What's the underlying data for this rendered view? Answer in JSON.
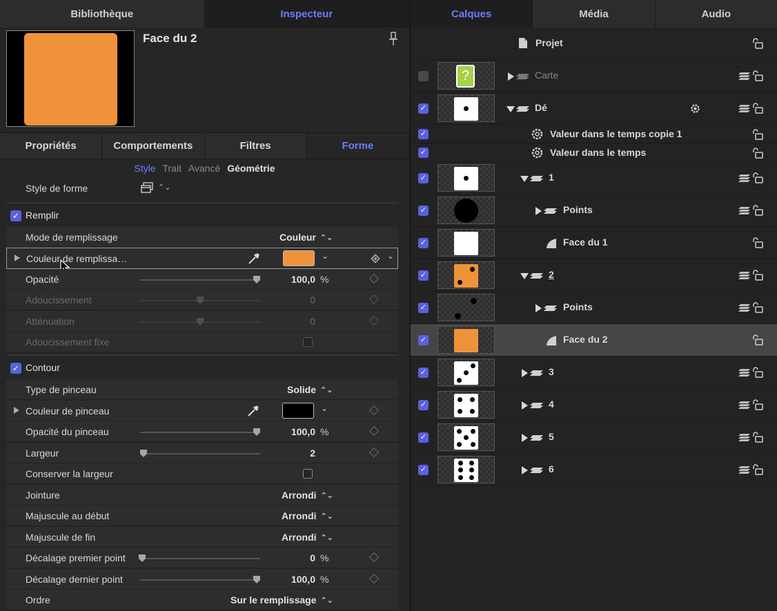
{
  "left_tabs": [
    "Bibliothèque",
    "Inspecteur"
  ],
  "right_tabs": [
    "Calques",
    "Média",
    "Audio"
  ],
  "inspector": {
    "object_title": "Face du 2",
    "sub_tabs": [
      "Propriétés",
      "Comportements",
      "Filtres",
      "Forme"
    ],
    "modes": [
      "Style",
      "Trait",
      "Avancé",
      "Géométrie"
    ],
    "shape_style_label": "Style de forme",
    "fill": {
      "section_label": "Remplir",
      "fill_mode_label": "Mode de remplissage",
      "fill_mode_value": "Couleur",
      "fill_color_label": "Couleur de remplissa…",
      "fill_color": "#f0923a",
      "opacity_label": "Opacité",
      "opacity_value": "100,0",
      "opacity_unit": "%",
      "opacity_fraction": 1.0,
      "feather_label": "Adoucissement",
      "feather_value": "0",
      "falloff_label": "Atténuation",
      "falloff_value": "0",
      "fixed_feather_label": "Adoucissement fixe"
    },
    "outline": {
      "section_label": "Contour",
      "brush_type_label": "Type de pinceau",
      "brush_type_value": "Solide",
      "brush_color_label": "Couleur de pinceau",
      "brush_color": "#000000",
      "brush_opacity_label": "Opacité du pinceau",
      "brush_opacity_value": "100,0",
      "brush_opacity_unit": "%",
      "width_label": "Largeur",
      "width_value": "2",
      "preserve_width_label": "Conserver la largeur",
      "joint_label": "Jointure",
      "joint_value": "Arrondi",
      "start_cap_label": "Majuscule au début",
      "start_cap_value": "Arrondi",
      "end_cap_label": "Majuscule de fin",
      "end_cap_value": "Arrondi",
      "first_offset_label": "Décalage premier point",
      "first_offset_value": "0",
      "first_offset_unit": "%",
      "last_offset_label": "Décalage dernier point",
      "last_offset_value": "100,0",
      "last_offset_unit": "%",
      "order_label": "Ordre",
      "order_value": "Sur le remplissage"
    }
  },
  "layers": {
    "project": "Projet",
    "items": [
      {
        "name": "Carte",
        "checked": false
      },
      {
        "name": "Dé",
        "checked": true
      },
      {
        "name": "Valeur dans le temps copie 1",
        "checked": true
      },
      {
        "name": "Valeur dans le temps",
        "checked": true
      },
      {
        "name": "1",
        "checked": true
      },
      {
        "name": "Points",
        "checked": true
      },
      {
        "name": "Face du 1",
        "checked": true
      },
      {
        "name": "2",
        "checked": true
      },
      {
        "name": "Points",
        "checked": true
      },
      {
        "name": "Face du 2",
        "checked": true,
        "selected": true
      },
      {
        "name": "3",
        "checked": true
      },
      {
        "name": "4",
        "checked": true
      },
      {
        "name": "5",
        "checked": true
      },
      {
        "name": "6",
        "checked": true
      }
    ],
    "card_glyph": "?"
  },
  "colors": {
    "accent": "#6b7cff",
    "checkbox": "#5a61e0",
    "orange": "#f0923a",
    "card_green": "#a8d04a"
  }
}
